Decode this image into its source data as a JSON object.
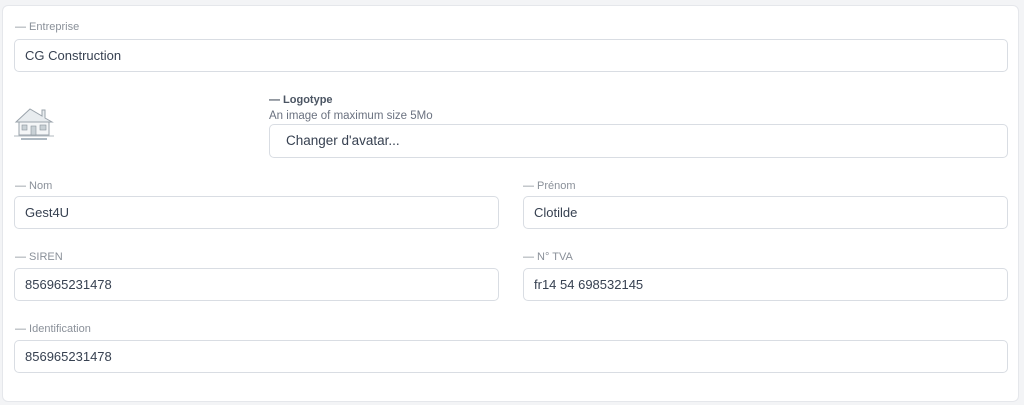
{
  "form": {
    "entreprise": {
      "label": "— Entreprise",
      "value": "CG Construction"
    },
    "logotype": {
      "label": "— Logotype",
      "hint": "An image of maximum size 5Mo",
      "button_label": "Changer d'avatar..."
    },
    "nom": {
      "label": "— Nom",
      "value": "Gest4U"
    },
    "prenom": {
      "label": "— Prénom",
      "value": "Clotilde"
    },
    "siren": {
      "label": "— SIREN",
      "value": "856965231478"
    },
    "tva": {
      "label": "— N° TVA",
      "value": "fr14 54 698532145"
    },
    "identification": {
      "label": "— Identification",
      "value": "856965231478"
    }
  },
  "logo_icon": "house-logo-icon",
  "colors": {
    "border": "#d9dde3",
    "label": "#8a9099",
    "text": "#374151",
    "background": "#f3f4f6"
  }
}
